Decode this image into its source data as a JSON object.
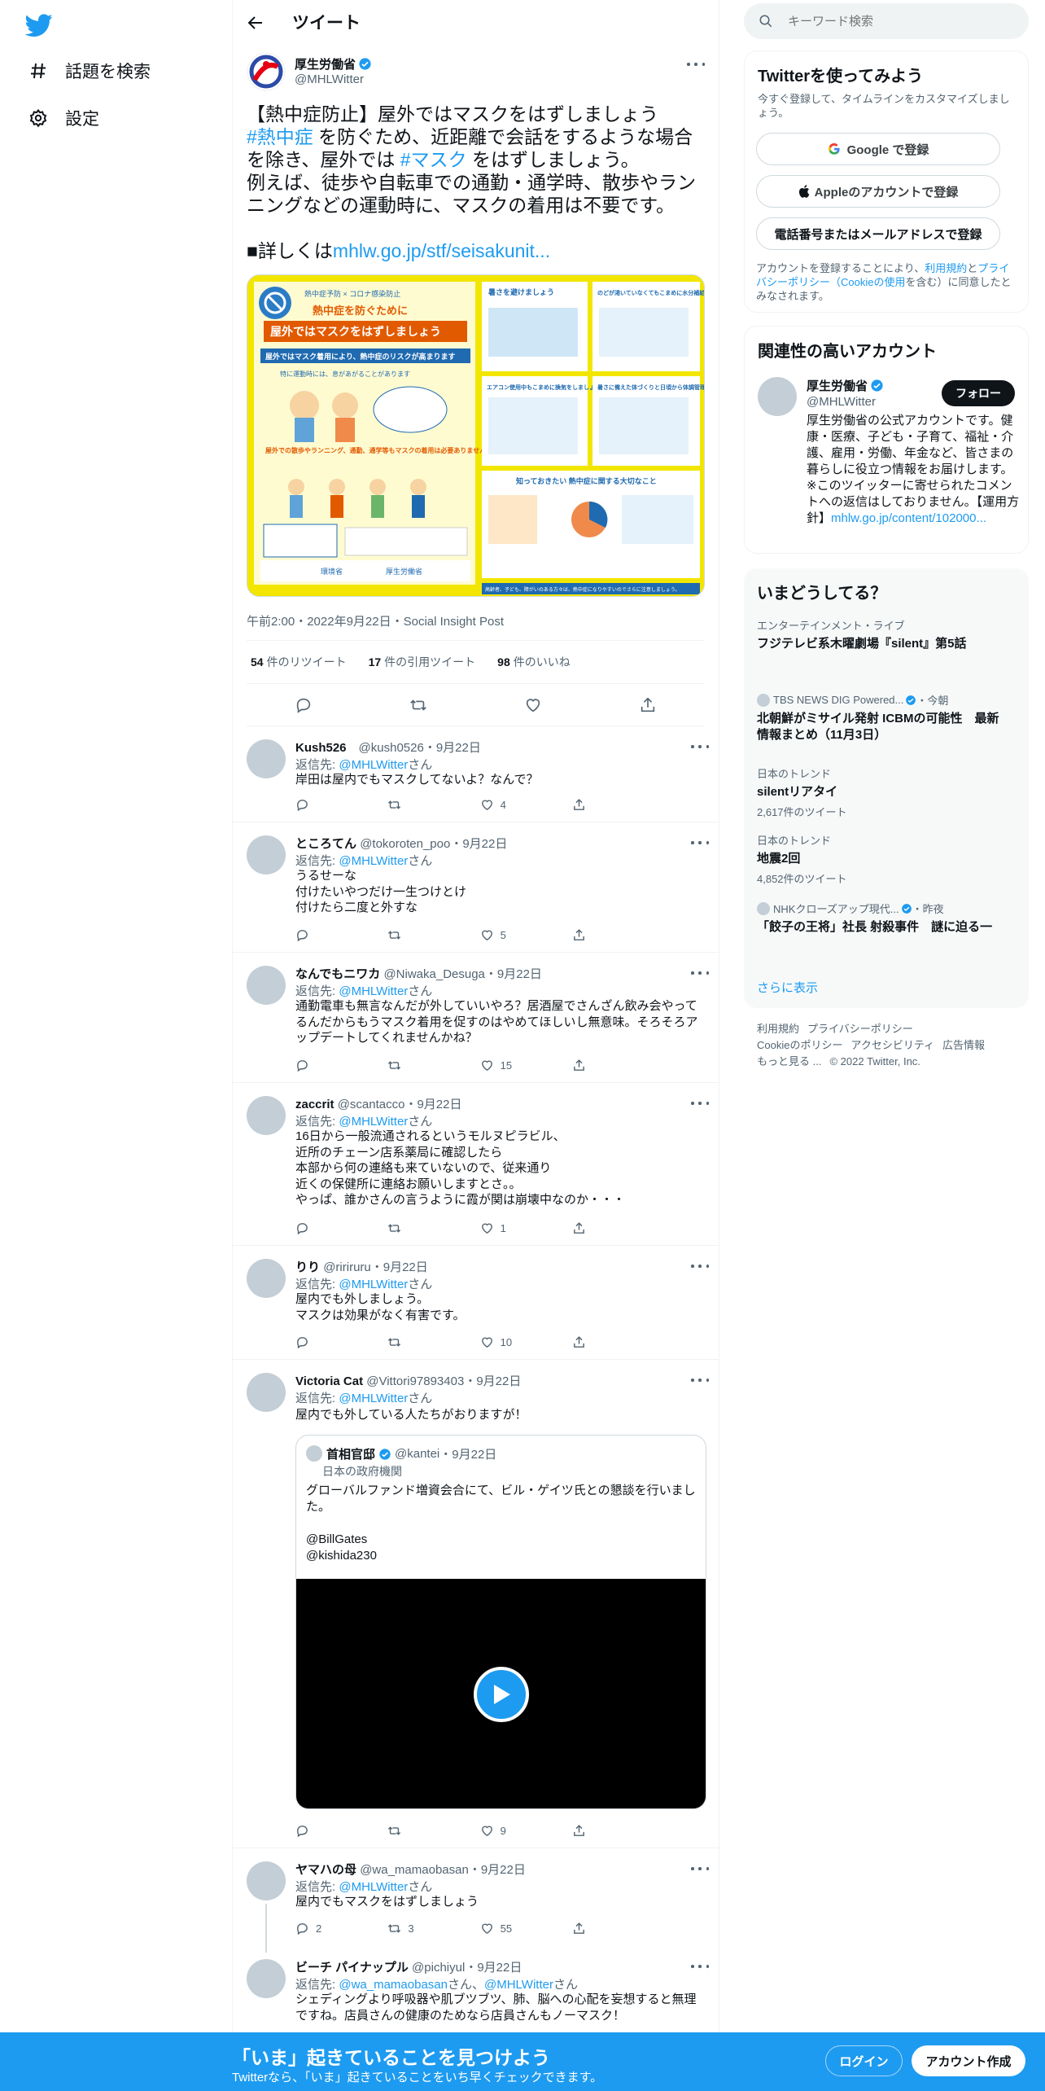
{
  "nav": {
    "explore_label": "話題を検索",
    "settings_label": "設定"
  },
  "header": {
    "title": "ツイート"
  },
  "tweet": {
    "author": "厚生労働省",
    "handle": "@MHLWitter",
    "text_lines": [
      {
        "parts": [
          "【熱中症防止】屋外ではマスクをはずしましょう"
        ]
      },
      {
        "hashtag": "#熱中症",
        "rest": " を防ぐため、近距離で会話をするような場合"
      },
      {
        "pre": "を除き、屋外では ",
        "hashtag": "#マスク",
        "rest": " をはずしましょう。"
      },
      {
        "parts": [
          "例えば、徒歩や自転車での通勤・通学時、散歩やラン"
        ]
      },
      {
        "parts": [
          "ニングなどの運動時に、マスクの着用は不要です。"
        ]
      },
      {
        "parts": [
          ""
        ]
      },
      {
        "pre": "■詳しくは",
        "link": "mhlw.go.jp/stf/seisakunit..."
      }
    ],
    "media": {
      "left_title_small": "熱中症予防 × コロナ感染防止",
      "left_title_1": "熱中症を防ぐために",
      "left_title_2": "屋外ではマスクをはずしましょう",
      "left_band": "屋外ではマスク着用により、熱中症のリスクが高まります",
      "left_sub1": "特に運動時には、息があがることがあります",
      "left_sub2": "屋外での散歩やランニング、通勤、通学等もマスクの着用は必要ありません",
      "left_footer_1": "環境省",
      "left_footer_2": "厚生労働省",
      "right_box1": "暑さを避けましょう",
      "right_box2": "のどが渇いていなくてもこまめに水分補給をしましょう",
      "right_box3": "エアコン使用中もこまめに換気をしましょう",
      "right_box4": "暑さに備えた体づくりと日頃から体調管理をしましょう",
      "right_box5": "知っておきたい 熱中症に関する大切なこと",
      "right_footer": "高齢者、子ども、障がいのある方々は、熱中症になりやすいのでさらに注意しましょう。"
    },
    "meta": "午前2:00・2022年9月22日・Social Insight Post",
    "stats": {
      "retweets_n": "54",
      "retweets_label": "件のリツイート",
      "quotes_n": "17",
      "quotes_label": "件の引用ツイート",
      "likes_n": "98",
      "likes_label": "件のいいね"
    }
  },
  "replies": [
    {
      "name": "Kush526",
      "handle": "@kush0526",
      "date": "・9月22日",
      "to_prefix": "返信先: ",
      "to_handle": "@MHLWitter",
      "to_suffix": "さん",
      "text": "岸田は屋内でもマスクしてないよ？なんで？",
      "likes": "4",
      "retweets": ""
    },
    {
      "name": "ところてん",
      "handle": "@tokoroten_poo",
      "date": "・9月22日",
      "to_prefix": "返信先: ",
      "to_handle": "@MHLWitter",
      "to_suffix": "さん",
      "text": "うるせーな\n付けたいやつだけ一生つけとけ\n付けたら二度と外すな",
      "likes": "5",
      "retweets": ""
    },
    {
      "name": "なんでもニワカ",
      "handle": "@Niwaka_Desuga",
      "date": "・9月22日",
      "to_prefix": "返信先: ",
      "to_handle": "@MHLWitter",
      "to_suffix": "さん",
      "text": "通勤電車も無言なんだが外していいやろ？居酒屋でさんざん飲み会やってるんだからもうマスク着用を促すのはやめてほしいし無意味。そろそろアップデートしてくれませんかね？",
      "likes": "15",
      "retweets": ""
    },
    {
      "name": "zaccrit",
      "handle": "@scantacco",
      "date": "・9月22日",
      "to_prefix": "返信先: ",
      "to_handle": "@MHLWitter",
      "to_suffix": "さん",
      "text": "16日から一般流通されるというモルヌピラビル、\n近所のチェーン店系薬局に確認したら\n本部から何の連絡も来ていないので、従来通り\n近くの保健所に連絡お願いしますとさ。。\nやっぱ、誰かさんの言うように霞が関は崩壊中なのか・・・",
      "likes": "1",
      "retweets": ""
    },
    {
      "name": "りり",
      "handle": "@ririruru",
      "date": "・9月22日",
      "to_prefix": "返信先: ",
      "to_handle": "@MHLWitter",
      "to_suffix": "さん",
      "text": "屋内でも外しましょう。\nマスクは効果がなく有害です。",
      "likes": "10",
      "retweets": ""
    },
    {
      "name": "Victoria Cat",
      "handle": "@Vittori97893403",
      "date": "・9月22日",
      "to_prefix": "返信先: ",
      "to_handle": "@MHLWitter",
      "to_suffix": "さん",
      "text": "屋内でも外している人たちがおりますが！",
      "likes": "9",
      "retweets": "",
      "quote": {
        "name": "首相官邸",
        "handle": "@kantei",
        "date": "・9月22日",
        "org": "日本の政府機関",
        "text": "グローバルファンド増資会合にて、ビル・ゲイツ氏との懇談を行いました。\n\n@BillGates\n@kishida230"
      }
    },
    {
      "name": "ヤマハの母",
      "handle": "@wa_mamaobasan",
      "date": "・9月22日",
      "to_prefix": "返信先: ",
      "to_handle": "@MHLWitter",
      "to_suffix": "さん",
      "text": "屋内でもマスクをはずしましょう",
      "likes": "55",
      "retweets": "3",
      "replies": "2"
    },
    {
      "name": "ビーチ パイナップル",
      "handle": "@pichiyul",
      "date": "・9月22日",
      "to_prefix": "返信先: ",
      "to_handle": "@wa_mamaobasan",
      "to_mid": "さん、",
      "to_handle2": "@MHLWitter",
      "to_suffix": "さん",
      "text": "シェディングより呼吸器や肌ブツブツ、肺、脳への心配を妄想すると無理ですね。店員さんの健康のためなら店員さんもノーマスク！"
    }
  ],
  "right": {
    "search_placeholder": "キーワード検索",
    "signup": {
      "title": "Twitterを使ってみよう",
      "subtitle": "今すぐ登録して、タイムラインをカスタマイズしましょう。",
      "google": "Google で登録",
      "apple": "Appleのアカウントで登録",
      "phone": "電話番号またはメールアドレスで登録",
      "terms_pre": "アカウントを登録することにより、",
      "terms_link1": "利用規約",
      "terms_and": "と",
      "terms_link2": "プライバシーポリシー（Cookieの使用",
      "terms_post": "を含む）に同意したとみなされます。"
    },
    "related": {
      "title": "関連性の高いアカウント",
      "name": "厚生労働省",
      "handle": "@MHLWitter",
      "follow": "フォロー",
      "bio": "厚生労働省の公式アカウントです。健康・医療、子ども・子育て、福祉・介護、雇用・労働、年金など、皆さまの暮らしに役立つ情報をお届けします。※このツイッターに寄せられたコメントへの返信はしておりません。【運用方針】",
      "bio_link": "mhlw.go.jp/content/102000..."
    },
    "trends": {
      "title": "いまどうしてる？",
      "items": [
        {
          "cat": "エンターテインメント・ライブ",
          "title": "フジテレビ系木曜劇場『silent』第5話",
          "count": ""
        },
        {
          "cat": "TBS NEWS DIG Powered...",
          "cat_suffix": "・今朝",
          "title": "北朝鮮がミサイル発射 ICBMの可能性　最新情報まとめ（11月3日）",
          "count": ""
        },
        {
          "cat": "日本のトレンド",
          "title": "silentリアタイ",
          "count": "2,617件のツイート"
        },
        {
          "cat": "日本のトレンド",
          "title": "地震2回",
          "count": "4,852件のツイート"
        },
        {
          "cat": "NHKクローズアップ現代...",
          "cat_suffix": "・昨夜",
          "title": "「餃子の王将」社長 射殺事件　謎に迫る一",
          "count": ""
        }
      ],
      "more": "さらに表示"
    },
    "footer": {
      "line1": [
        "利用規約",
        "プライバシーポリシー"
      ],
      "line2": [
        "Cookieのポリシー",
        "アクセシビリティ",
        "広告情報"
      ],
      "line3": [
        "もっと見る ...",
        "© 2022 Twitter, Inc."
      ]
    }
  },
  "banner": {
    "title": "「いま」起きていることを見つけよう",
    "subtitle": "Twitterなら、「いま」起きていることをいち早くチェックできます。",
    "login": "ログイン",
    "signup": "アカウント作成"
  },
  "colors": {
    "accent": "#1d9bf0",
    "text": "#0f1419",
    "muted": "#536471",
    "border": "#eff3f4"
  }
}
